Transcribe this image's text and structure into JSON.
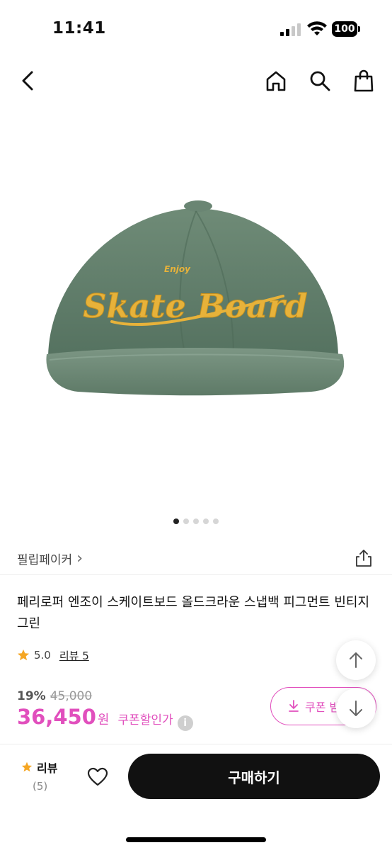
{
  "status_bar": {
    "time": "11:41",
    "battery": "100"
  },
  "nav": {
    "back_icon": "chevron-left-icon",
    "home_icon": "home-icon",
    "search_icon": "search-icon",
    "bag_icon": "shopping-bag-icon"
  },
  "product_image": {
    "description_icon": "green-cap-image",
    "cap_text_small": "Enjoy",
    "cap_text_main": "Skate Board",
    "cap_color": "#5e7a67",
    "embroidery_color": "#e7b23a",
    "carousel_total": 5,
    "carousel_active": 1
  },
  "brand": {
    "name": "필립페이커",
    "chevron": "›"
  },
  "product": {
    "title": "페리로퍼 엔조이 스케이트보드 올드크라운 스냅백 피그먼트 빈티지 그린",
    "rating": "5.0",
    "review_label": "리뷰 5"
  },
  "price": {
    "discount_rate": "19%",
    "original_price": "45,000",
    "sale_price": "36,450",
    "currency": "원",
    "coupon_price_label": "쿠폰할인가",
    "info_icon_text": "i"
  },
  "coupon_button": {
    "label": "쿠폰 받"
  },
  "bottom_bar": {
    "review_label": "리뷰",
    "review_count": "(5)",
    "buy_label": "구매하기"
  },
  "colors": {
    "accent": "#e14fbd",
    "star": "#f5a623",
    "buy_button": "#111111"
  }
}
